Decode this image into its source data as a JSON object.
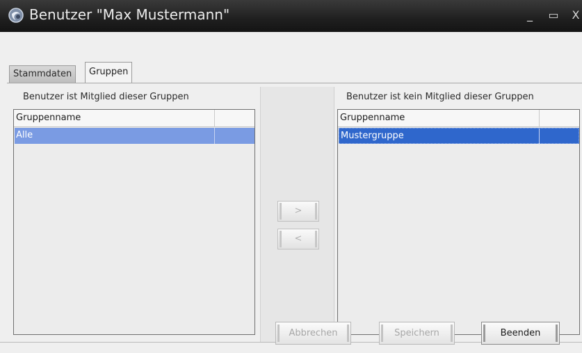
{
  "window": {
    "title": "Benutzer \"Max Mustermann\"",
    "app_icon": "app-globe-icon",
    "minimize_symbol": "_",
    "maximize_symbol": "▭",
    "close_symbol": "X"
  },
  "tabs": [
    {
      "label": "Stammdaten",
      "active": false
    },
    {
      "label": "Gruppen",
      "active": true
    }
  ],
  "member_panel": {
    "title": "Benutzer ist Mitglied dieser Gruppen",
    "column_header": "Gruppenname",
    "rows": [
      "Alle"
    ]
  },
  "non_member_panel": {
    "title": "Benutzer ist kein Mitglied dieser Gruppen",
    "column_header": "Gruppenname",
    "rows": [
      "Mustergruppe"
    ]
  },
  "transfer": {
    "add_label": ">",
    "remove_label": "<"
  },
  "footer": {
    "cancel_label": "Abbrechen",
    "save_label": "Speichern",
    "close_label": "Beenden"
  },
  "colors": {
    "titlebar": "#1f1f1f",
    "selection_left": "#7a9be3",
    "selection_right": "#2f67cc"
  }
}
